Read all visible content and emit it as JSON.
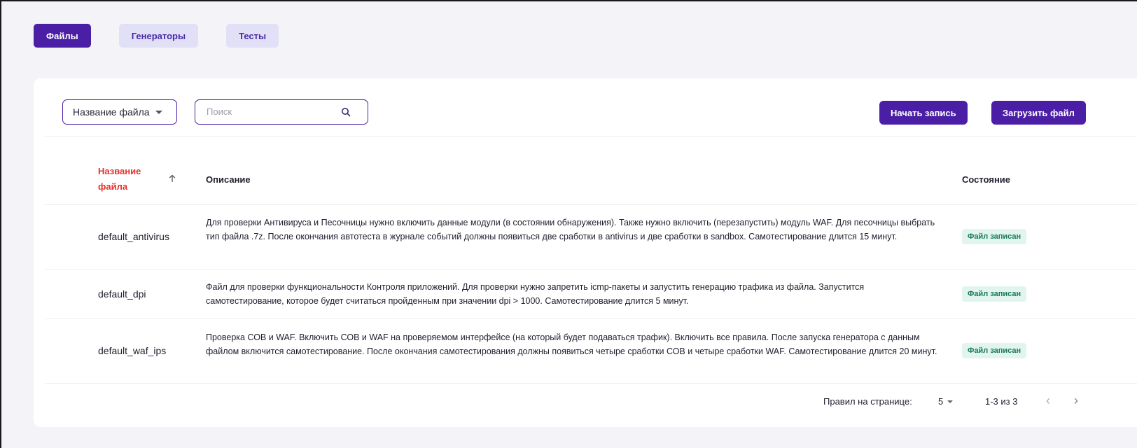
{
  "tabs": [
    {
      "label": "Файлы",
      "active": true
    },
    {
      "label": "Генераторы",
      "active": false
    },
    {
      "label": "Тесты",
      "active": false
    }
  ],
  "toolbar": {
    "filter_select": "Название файла",
    "search_placeholder": "Поиск",
    "record_button": "Начать запись",
    "upload_button": "Загрузить файл"
  },
  "table": {
    "columns": {
      "name": "Название файла",
      "description": "Описание",
      "state": "Состояние"
    },
    "sort": {
      "column": "name",
      "direction": "ascending"
    },
    "rows": [
      {
        "name": "default_antivirus",
        "description": "Для проверки Антивируса и Песочницы нужно включить данные модули (в состоянии обнаружения). Также нужно включить (перезапустить) модуль WAF. Для песочницы выбрать тип файла .7z. После окончания автотеста в журнале событий должны появиться две сработки в antivirus и две сработки в sandbox. Самотестирование длится 15 минут.",
        "state": "Файл записан"
      },
      {
        "name": "default_dpi",
        "description": "Файл для проверки функциональности Контроля приложений. Для проверки нужно запретить icmp-пакеты и запустить генерацию трафика из файла. Запустится самотестирование, которое будет считаться пройденным при значении dpi > 1000. Самотестирование длится 5 минут.",
        "state": "Файл записан"
      },
      {
        "name": "default_waf_ips",
        "description": "Проверка СОВ и WAF. Включить СОВ и WAF на проверяемом интерфейсе (на который будет подаваться трафик). Включить все правила. После запуска генератора с данным файлом включится самотестирование. После окончания самотестирования должны появиться четыре сработки СОВ и четыре сработки WAF. Самотестирование длится 20 минут.",
        "state": "Файл записан"
      }
    ]
  },
  "pagination": {
    "rows_per_page_label": "Правил на странице:",
    "rows_per_page_value": "5",
    "range": "1-3 из 3"
  },
  "colors": {
    "accent": "#4b1fa5",
    "tab_inactive_bg": "#e2e0f6",
    "sorted_header": "#e5322d",
    "badge_bg": "#e1f5ee",
    "badge_text": "#1a7a56"
  }
}
